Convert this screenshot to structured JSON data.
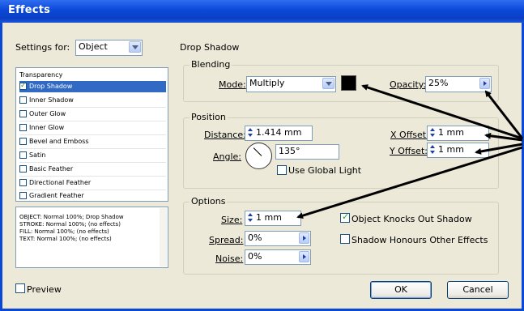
{
  "window": {
    "title": "Effects"
  },
  "settings_for": {
    "label": "Settings for:",
    "value": "Object"
  },
  "section_title": "Drop Shadow",
  "effects_list": {
    "header": "Transparency",
    "items": [
      {
        "label": "Drop Shadow",
        "checked": true,
        "selected": true
      },
      {
        "label": "Inner Shadow",
        "checked": false
      },
      {
        "label": "Outer Glow",
        "checked": false
      },
      {
        "label": "Inner Glow",
        "checked": false
      },
      {
        "label": "Bevel and Emboss",
        "checked": false
      },
      {
        "label": "Satin",
        "checked": false
      },
      {
        "label": "Basic Feather",
        "checked": false
      },
      {
        "label": "Directional Feather",
        "checked": false
      },
      {
        "label": "Gradient Feather",
        "checked": false
      }
    ]
  },
  "summary": {
    "lines": [
      "OBJECT: Normal 100%; Drop Shadow",
      "STROKE: Normal 100%; (no effects)",
      "FILL: Normal 100%; (no effects)",
      "TEXT: Normal 100%; (no effects)"
    ]
  },
  "blending": {
    "title": "Blending",
    "mode_label": "Mode:",
    "mode_value": "Multiply",
    "swatch_color": "#000000",
    "opacity_label": "Opacity:",
    "opacity_value": "25%"
  },
  "position": {
    "title": "Position",
    "distance_label": "Distance:",
    "distance_value": "1.414 mm",
    "angle_label": "Angle:",
    "angle_value": "135°",
    "global_light_label": "Use Global Light",
    "x_offset_label": "X Offset:",
    "x_offset_value": "1 mm",
    "y_offset_label": "Y Offset:",
    "y_offset_value": "1 mm"
  },
  "options": {
    "title": "Options",
    "size_label": "Size:",
    "size_value": "1 mm",
    "spread_label": "Spread:",
    "spread_value": "0%",
    "noise_label": "Noise:",
    "noise_value": "0%",
    "knockout_label": "Object Knocks Out Shadow",
    "honours_label": "Shadow Honours Other Effects"
  },
  "footer": {
    "preview_label": "Preview",
    "ok_label": "OK",
    "cancel_label": "Cancel"
  },
  "colors": {
    "title_bar": "#0b48d8",
    "selection": "#316ac5",
    "dialog_bg": "#ece9d8"
  }
}
